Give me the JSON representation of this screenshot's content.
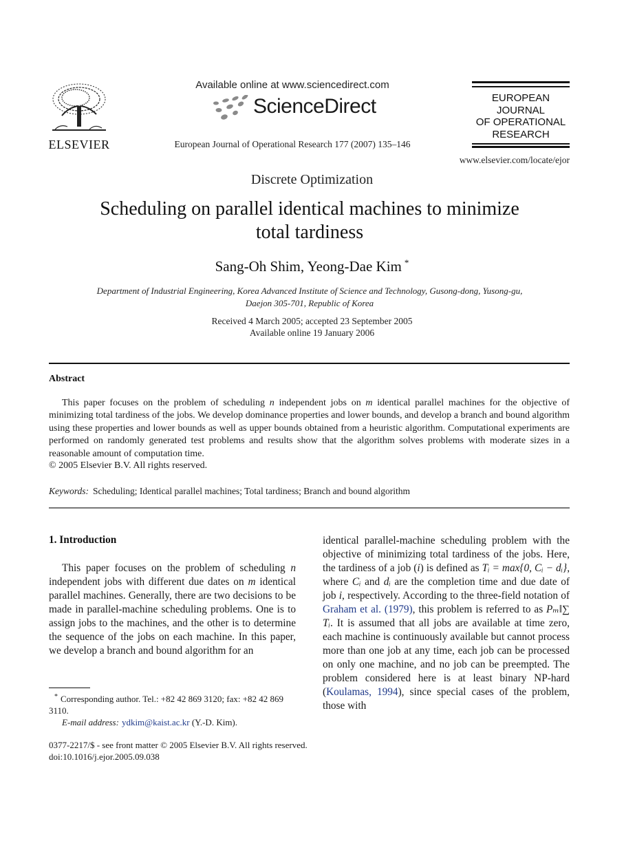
{
  "header": {
    "publisher_logo_text": "ELSEVIER",
    "available_online": "Available online at www.sciencedirect.com",
    "sciencedirect_logo": "ScienceDirect",
    "journal_reference": "European Journal of Operational Research 177 (2007) 135–146",
    "journal_logo_lines": [
      "EUROPEAN",
      "JOURNAL",
      "OF OPERATIONAL",
      "RESEARCH"
    ],
    "journal_url": "www.elsevier.com/locate/ejor"
  },
  "article": {
    "section": "Discrete Optimization",
    "title_line1": "Scheduling on parallel identical machines to minimize",
    "title_line2": "total tardiness",
    "authors": "Sang-Oh Shim, Yeong-Dae Kim",
    "corresponding_mark": "*",
    "affiliation_line1": "Department of Industrial Engineering, Korea Advanced Institute of Science and Technology, Gusong-dong, Yusong-gu,",
    "affiliation_line2": "Daejon 305-701, Republic of Korea",
    "received": "Received 4 March 2005; accepted 23 September 2005",
    "available_online": "Available online 19 January 2006"
  },
  "abstract": {
    "heading": "Abstract",
    "seg1": "This paper focuses on the problem of scheduling ",
    "var_n": "n",
    "seg2": " independent jobs on ",
    "var_m": "m",
    "seg3": " identical parallel machines for the objective of minimizing total tardiness of the jobs. We develop dominance properties and lower bounds, and develop a branch and bound algorithm using these properties and lower bounds as well as upper bounds obtained from a heuristic algorithm. Computational experiments are performed on randomly generated test problems and results show that the algorithm solves problems with moderate sizes in a reasonable amount of computation time.",
    "copyright": "© 2005 Elsevier B.V. All rights reserved.",
    "keywords_label": "Keywords:",
    "keywords": "Scheduling; Identical parallel machines; Total tardiness; Branch and bound algorithm"
  },
  "introduction": {
    "heading": "1. Introduction",
    "left_seg1": "This paper focuses on the problem of scheduling ",
    "left_var_n": "n",
    "left_seg2": " independent jobs with different due dates on ",
    "left_var_m": "m",
    "left_seg3": " identical parallel machines. Generally, there are two decisions to be made in parallel-machine scheduling problems. One is to assign jobs to the machines, and the other is to determine the sequence of the jobs on each machine. In this paper, we develop a branch and bound algorithm for an",
    "right_seg1": "identical parallel-machine scheduling problem with the objective of minimizing total tardiness of the jobs. Here, the tardiness of a job (",
    "right_var_i1": "i",
    "right_seg2": ") is defined as ",
    "right_formula": "Tᵢ = max{0, Cᵢ − dᵢ}",
    "right_seg3": ", where ",
    "right_var_ci": "Cᵢ",
    "right_seg4": " and ",
    "right_var_di": "dᵢ",
    "right_seg5": " are the completion time and due date of job ",
    "right_var_i2": "i",
    "right_seg6": ", respectively. According to the three-field notation of ",
    "ref_graham": "Graham et al. (1979)",
    "right_seg7": ", this problem is referred to as ",
    "right_notation": "Pₘ‖∑ Tᵢ",
    "right_seg8": ". It is assumed that all jobs are available at time zero, each machine is continuously available but cannot process more than one job at any time, each job can be processed on only one machine, and no job can be preempted. The problem considered here is at least binary NP-hard (",
    "ref_koulamas": "Koulamas, 1994",
    "right_seg9": "), since special cases of the problem, those with"
  },
  "footnote": {
    "mark": "*",
    "text": "Corresponding author. Tel.: +82 42 869 3120; fax: +82 42 869 3110.",
    "email_label": "E-mail address:",
    "email": "ydkim@kaist.ac.kr",
    "email_suffix": " (Y.-D. Kim)."
  },
  "footer": {
    "issn_line": "0377-2217/$ - see front matter  © 2005 Elsevier B.V. All rights reserved.",
    "doi": "doi:10.1016/j.ejor.2005.09.038"
  },
  "colors": {
    "link": "#1f3a8a",
    "text": "#1a1a1a",
    "rule_dark": "#111111",
    "rule_grey": "#777777"
  }
}
